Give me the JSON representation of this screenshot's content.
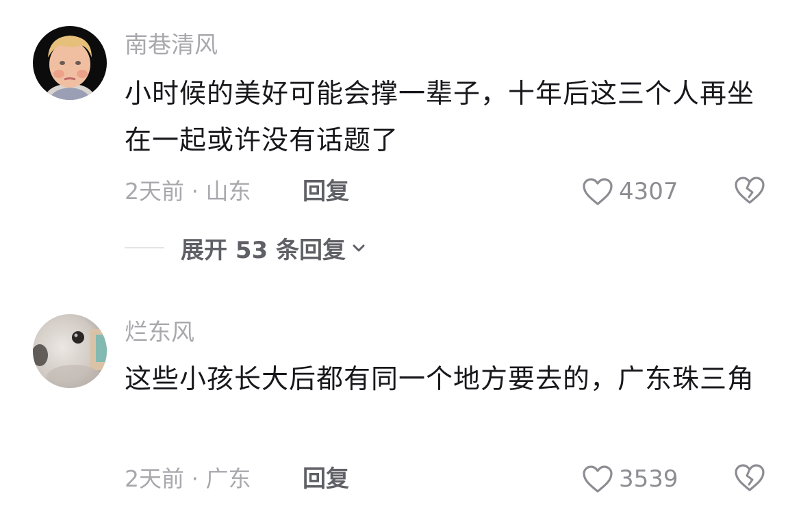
{
  "comments": [
    {
      "username": "南巷清风",
      "avatar_icon": "child-avatar",
      "text": "小时候的美好可能会撑一辈子，十年后这三个人再坐在一起或许没有话题了",
      "meta": "2天前 · 山东",
      "reply_label": "回复",
      "like_count": "4307",
      "like_icon": "heart-icon",
      "dislike_icon": "broken-heart-icon",
      "expand_label": "展开 53 条回复"
    },
    {
      "username": "烂东风",
      "avatar_icon": "dog-avatar",
      "text": "这些小孩长大后都有同一个地方要去的，广东珠三角",
      "meta": "2天前 · 广东",
      "reply_label": "回复",
      "like_count": "3539",
      "like_icon": "heart-icon",
      "dislike_icon": "broken-heart-icon"
    }
  ],
  "colors": {
    "text_primary": "#18181c",
    "text_secondary": "#a8a8ad",
    "action": "#5f5f66",
    "icon": "#8c8c92"
  }
}
